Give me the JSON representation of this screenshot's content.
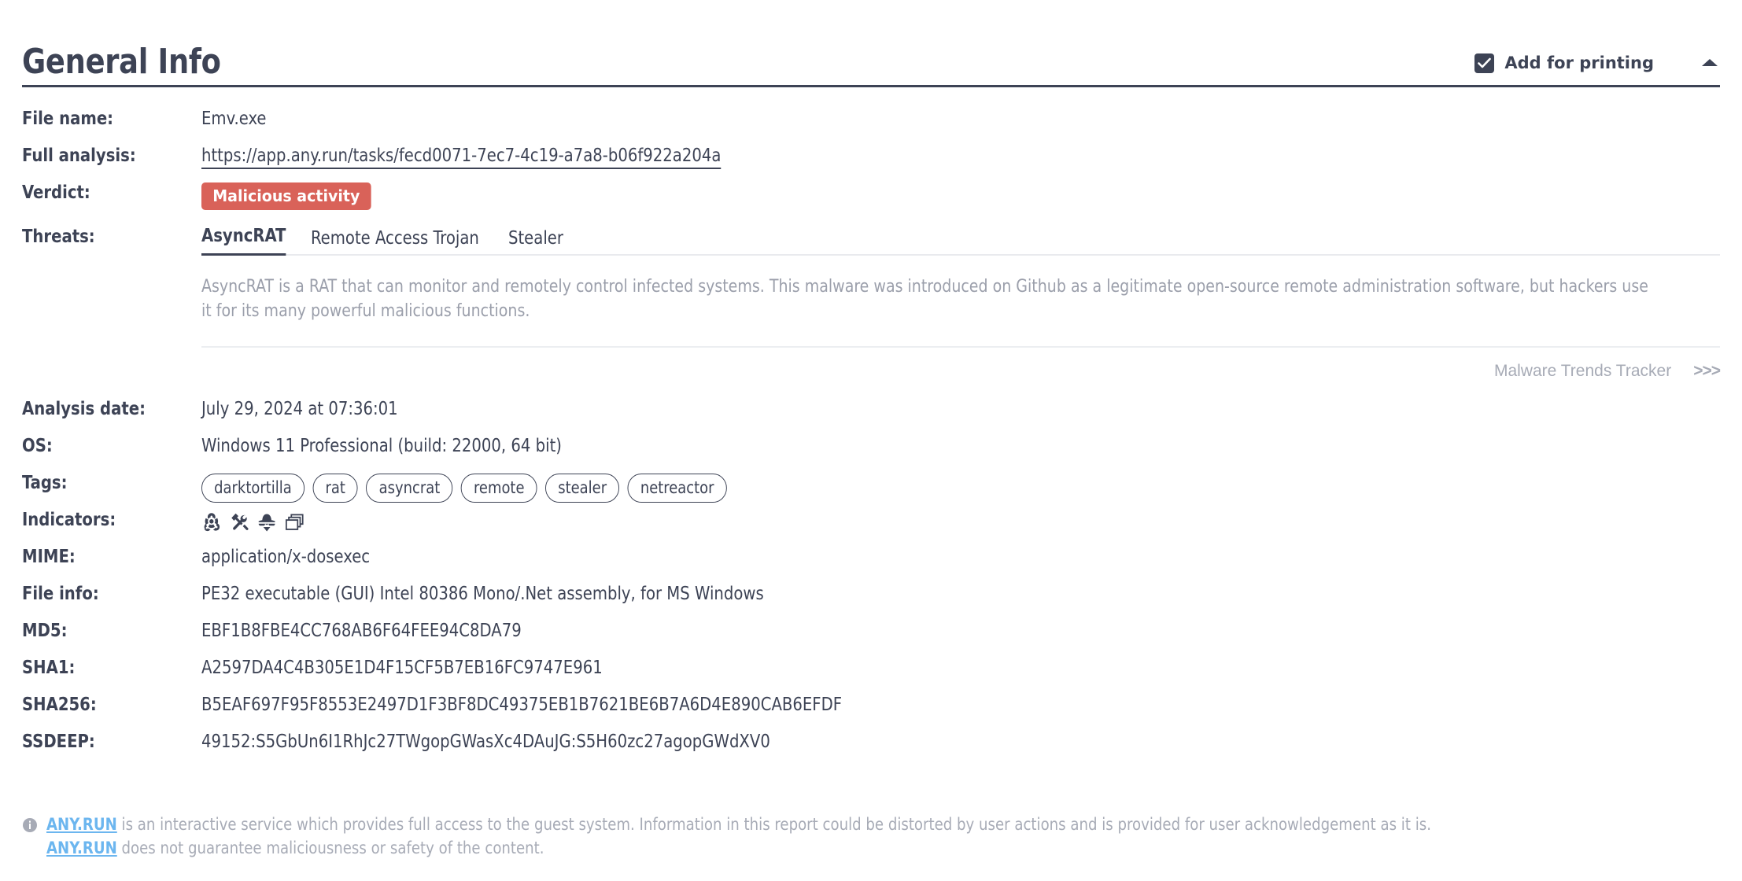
{
  "header": {
    "title": "General Info",
    "print_checkbox_label": "Add for printing",
    "print_checkbox_checked": true,
    "collapse_icon": "chevron-up-icon"
  },
  "fields": {
    "file_name_label": "File name:",
    "file_name_value": "Emv.exe",
    "full_analysis_label": "Full analysis:",
    "full_analysis_value": "https://app.any.run/tasks/fecd0071-7ec7-4c19-a7a8-b06f922a204a",
    "verdict_label": "Verdict:",
    "verdict_value": "Malicious activity",
    "verdict_color": "#d96259",
    "threats_label": "Threats:",
    "analysis_date_label": "Analysis date:",
    "analysis_date_value": "July 29, 2024 at 07:36:01",
    "os_label": "OS:",
    "os_value": "Windows 11 Professional (build: 22000, 64 bit)",
    "tags_label": "Tags:",
    "indicators_label": "Indicators:",
    "mime_label": "MIME:",
    "mime_value": "application/x-dosexec",
    "file_info_label": "File info:",
    "file_info_value": "PE32 executable (GUI) Intel 80386 Mono/.Net assembly, for MS Windows",
    "md5_label": "MD5:",
    "md5_value": "EBF1B8FBE4CC768AB6F64FEE94C8DA79",
    "sha1_label": "SHA1:",
    "sha1_value": "A2597DA4C4B305E1D4F15CF5B7EB16FC9747E961",
    "sha256_label": "SHA256:",
    "sha256_value": "B5EAF697F95F8553E2497D1F3BF8DC49375EB1B7621BE6B7A6D4E890CAB6EFDF",
    "ssdeep_label": "SSDEEP:",
    "ssdeep_value": "49152:S5GbUn6I1RhJc27TWgopGWasXc4DAuJG:S5H60zc27agopGWdXV0"
  },
  "threats": {
    "tabs": [
      {
        "label": "AsyncRAT",
        "active": true
      },
      {
        "label": "Remote Access Trojan",
        "active": false
      },
      {
        "label": "Stealer",
        "active": false
      }
    ],
    "description": "AsyncRAT is a RAT that can monitor and remotely control infected systems. This malware was introduced on Github as a legitimate open-source remote administration software, but hackers use it for its many powerful malicious functions.",
    "trends_link": "Malware Trends Tracker",
    "trends_arrows": ">>>"
  },
  "tags": [
    "darktortilla",
    "rat",
    "asyncrat",
    "remote",
    "stealer",
    "netreactor"
  ],
  "indicators": [
    {
      "name": "biohazard-icon"
    },
    {
      "name": "tools-icon"
    },
    {
      "name": "spy-icon"
    },
    {
      "name": "windows-stack-icon"
    }
  ],
  "footer": {
    "icon": "info-icon",
    "link_1": "ANY.RUN",
    "text_1": " is an interactive service which provides full access to the guest system. Information in this report could be distorted by user actions and is provided for user acknowledgement as it is.",
    "link_2": "ANY.RUN",
    "text_2": " does not guarantee maliciousness or safety of the content."
  }
}
